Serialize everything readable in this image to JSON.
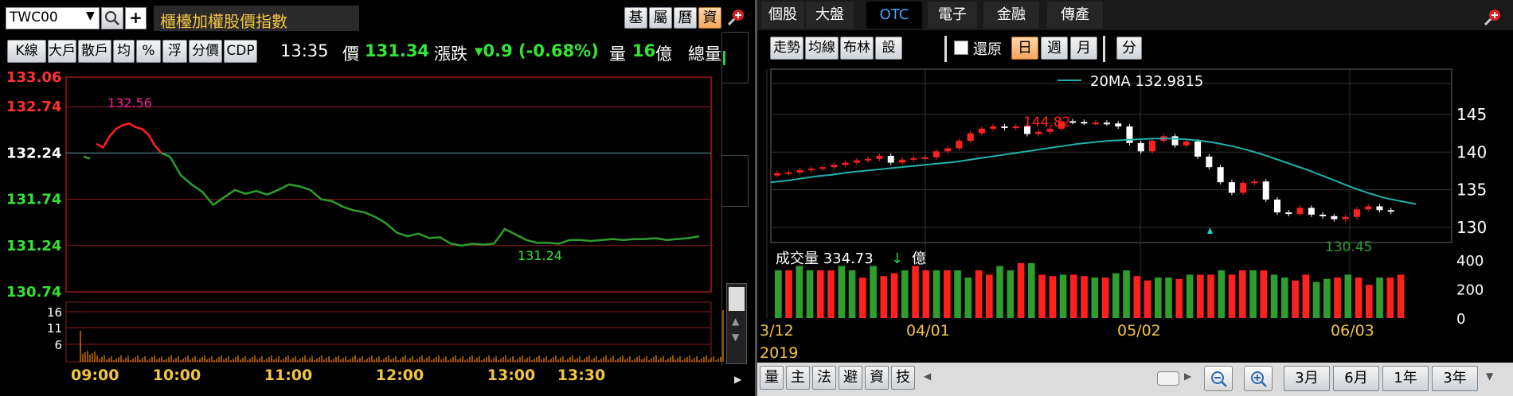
{
  "left": {
    "symbol": "TWC00",
    "index_name": "櫃檯加權股價指數",
    "corner_buttons": [
      "基",
      "屬",
      "曆",
      "資"
    ],
    "toolbar_buttons": [
      "K線",
      "大戶",
      "散戶",
      "均",
      "%",
      "浮",
      "分價",
      "CDP"
    ],
    "quote": {
      "time": "13:35",
      "price_label": "價",
      "price": "131.34",
      "change_label": "漲跌",
      "change": "▾0.9 (-0.68%)",
      "volume_label": "量",
      "volume": "16",
      "volume_unit": "億",
      "total_label": "總量"
    }
  },
  "right": {
    "tabs": [
      "個股",
      "大盤",
      "OTC",
      "電子",
      "金融",
      "傳產"
    ],
    "active_tab": "OTC",
    "buttons_left": [
      "走勢",
      "均線",
      "布林",
      "設"
    ],
    "restore_label": "還原",
    "period_buttons": [
      "日",
      "週",
      "月"
    ],
    "active_period": "日",
    "fen_label": "分",
    "legend": "20MA 132.9815",
    "volume_title": "成交量 334.73",
    "volume_arrow": "↓",
    "volume_unit": "億",
    "bottom_icons": [
      "量",
      "主",
      "法",
      "避",
      "資",
      "技"
    ],
    "range_buttons": [
      "3月",
      "6月",
      "1年",
      "3年"
    ]
  },
  "chart_data": [
    {
      "type": "line",
      "title": "櫃檯加權股價指數",
      "x_ticks": [
        "09:00",
        "10:00",
        "11:00",
        "12:00",
        "13:00",
        "13:30"
      ],
      "y_ticks": [
        "133.06",
        "132.74",
        "132.24",
        "131.74",
        "131.24",
        "130.74"
      ],
      "ylim": [
        130.74,
        133.06
      ],
      "reference": 132.24,
      "high_label": "132.56",
      "low_label": "131.24",
      "volume_ticks": [
        "16",
        "11",
        "6"
      ],
      "series": [
        {
          "x_minutes": [
            0,
            3,
            6,
            9,
            12,
            15,
            18,
            21,
            24,
            27,
            30,
            33,
            36,
            40,
            45,
            50,
            55,
            60,
            65,
            70,
            75,
            80,
            85,
            90,
            95,
            100,
            105,
            110,
            115,
            120,
            125,
            130,
            135,
            140,
            145,
            150,
            155,
            160,
            165,
            170,
            175,
            180,
            185,
            190,
            195,
            200,
            205,
            210,
            215,
            220,
            225,
            230,
            235,
            240,
            245,
            250,
            255,
            260,
            265,
            270,
            275,
            280,
            285
          ],
          "values": [
            132.2,
            132.18,
            132.34,
            132.3,
            132.42,
            132.5,
            132.54,
            132.56,
            132.52,
            132.5,
            132.44,
            132.32,
            132.24,
            132.2,
            132.0,
            131.9,
            131.82,
            131.68,
            131.76,
            131.84,
            131.8,
            131.83,
            131.79,
            131.84,
            131.9,
            131.88,
            131.84,
            131.74,
            131.72,
            131.66,
            131.62,
            131.6,
            131.55,
            131.48,
            131.38,
            131.34,
            131.37,
            131.32,
            131.33,
            131.26,
            131.24,
            131.26,
            131.25,
            131.26,
            131.42,
            131.36,
            131.3,
            131.27,
            131.27,
            131.26,
            131.3,
            131.3,
            131.29,
            131.3,
            131.31,
            131.3,
            131.31,
            131.31,
            131.32,
            131.3,
            131.31,
            131.32,
            131.34
          ]
        }
      ]
    },
    {
      "type": "candlestick",
      "x_ticks": [
        "3/12",
        "04/01",
        "05/02",
        "06/03"
      ],
      "year_label": "2019",
      "y_ticks": [
        "145",
        "140",
        "135",
        "130"
      ],
      "ylim": [
        128,
        151
      ],
      "high_label": "144.82",
      "low_label": "130.45",
      "ma20": [
        136,
        136.2,
        136.5,
        136.8,
        137,
        137.3,
        137.5,
        137.7,
        137.9,
        138.1,
        138.3,
        138.5,
        138.7,
        139,
        139.3,
        139.6,
        139.9,
        140.2,
        140.5,
        140.8,
        141.1,
        141.3,
        141.5,
        141.6,
        141.7,
        141.8,
        141.8,
        141.7,
        141.5,
        141.2,
        140.8,
        140.3,
        139.7,
        139,
        138.3,
        137.6,
        136.8,
        136,
        135.2,
        134.5,
        133.9,
        133.5,
        133.1
      ],
      "close": [
        137.2,
        137.3,
        137.6,
        137.8,
        138,
        138.3,
        138.6,
        138.9,
        139.1,
        139.5,
        138.6,
        139,
        139.2,
        139.3,
        140.1,
        140.5,
        141.5,
        142.5,
        143.1,
        143.4,
        143.2,
        143.4,
        142.4,
        142.7,
        143.1,
        144.1,
        144.0,
        143.9,
        143.9,
        143.8,
        143.4,
        141.2,
        140.1,
        141.5,
        142.1,
        140.9,
        141.4,
        139.4,
        138.0,
        136.0,
        134.6,
        135.9,
        136.1,
        133.7,
        132.0,
        131.8,
        132.6,
        131.7,
        131.5,
        131.1,
        131.4,
        132.4,
        132.8,
        132.3,
        132.1
      ],
      "volume_ticks": [
        "400",
        "200",
        "0"
      ],
      "volume": [
        330,
        330,
        360,
        330,
        330,
        330,
        360,
        330,
        280,
        360,
        290,
        310,
        330,
        360,
        330,
        330,
        330,
        330,
        280,
        330,
        300,
        360,
        330,
        380,
        380,
        300,
        290,
        300,
        300,
        290,
        280,
        280,
        310,
        330,
        290,
        260,
        280,
        280,
        270,
        300,
        300,
        300,
        330,
        300,
        330,
        330,
        330,
        300,
        280,
        260,
        300,
        250,
        270,
        280,
        300,
        280,
        230,
        280,
        280,
        300
      ]
    }
  ]
}
